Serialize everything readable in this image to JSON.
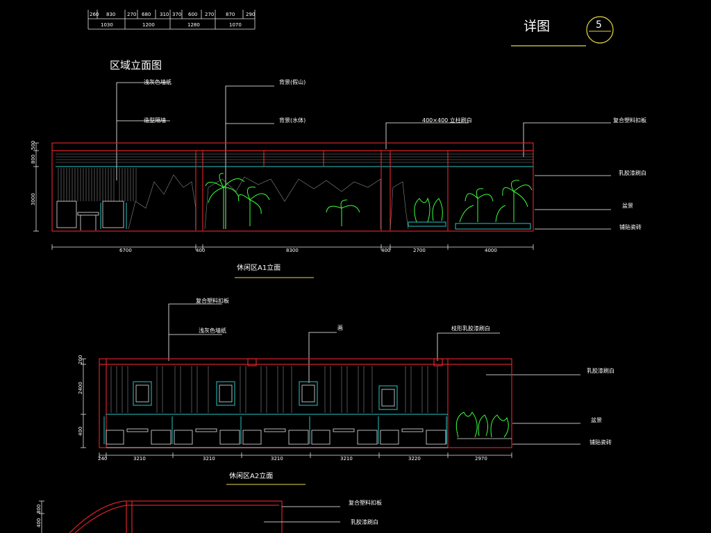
{
  "title_area": {
    "detail_label": "详图",
    "detail_number": "5"
  },
  "top_table": {
    "row1": [
      "260",
      "830",
      "270",
      "680",
      "310",
      "370",
      "600",
      "270",
      "870",
      "290"
    ],
    "row2": [
      "1030",
      "1200",
      "1280",
      "1070"
    ]
  },
  "section_heading": "区域立面图",
  "elevation_a1": {
    "caption": "休闲区A1立面",
    "notes": {
      "n1": "浅灰色墙纸",
      "n2": "造型隔墙",
      "n3": "背景(假山)",
      "n4": "背景(水体)",
      "n5": "400×400 立柱刷白",
      "n6": "复合塑料扣板",
      "n7": "乳胶漆刷白",
      "n8": "盆景",
      "n9": "铺贴瓷砖"
    },
    "left_dims": [
      "500",
      "800",
      "3000"
    ],
    "bottom_dims": [
      "6700",
      "400",
      "8300",
      "400",
      "2700",
      "4000"
    ]
  },
  "elevation_a2": {
    "caption": "休闲区A2立面",
    "notes": {
      "n1": "复合塑料扣板",
      "n2": "浅灰色墙纸",
      "n3": "画",
      "n4": "枝形乳胶漆刷白",
      "n5": "乳胶漆刷白",
      "n6": "盆景",
      "n7": "铺贴瓷砖"
    },
    "left_dims": [
      "200",
      "2400",
      "400"
    ],
    "bottom_dims": [
      "240",
      "3210",
      "3210",
      "3210",
      "3210",
      "3220",
      "2970"
    ]
  },
  "elevation_a3": {
    "notes": {
      "n1": "复合塑料扣板",
      "n2": "乳胶漆刷白"
    },
    "left_dims": [
      "800",
      "400"
    ]
  }
}
